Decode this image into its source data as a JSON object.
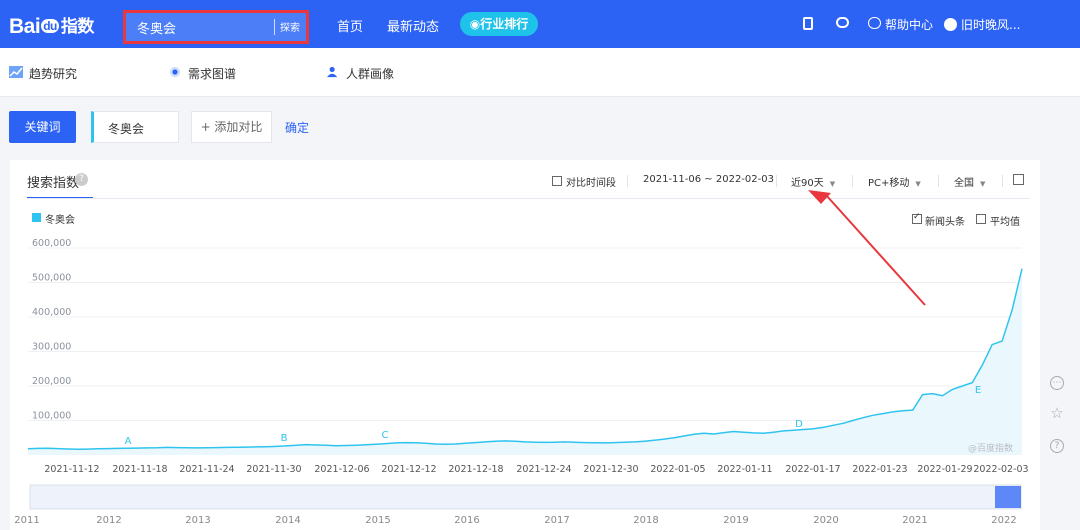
{
  "header": {
    "logo_text": "Bai",
    "logo_du": "du",
    "logo_zh": "指数",
    "search_value": "冬奥会",
    "search_button": "探索",
    "nav": [
      "首页",
      "最新动态"
    ],
    "rank_button": "行业排行",
    "help": "帮助中心",
    "user": "旧时晚风..."
  },
  "subnav": [
    "趋势研究",
    "需求图谱",
    "人群画像"
  ],
  "keyword_bar": {
    "label": "关键词",
    "keyword": "冬奥会",
    "add_compare": "+ 添加对比",
    "confirm": "确定"
  },
  "panel": {
    "title": "搜索指数",
    "qmark": "?",
    "compare_period": "对比时间段",
    "date_range": "2021-11-06 ~ 2022-02-03",
    "period": "近90天",
    "device": "PC+移动",
    "region": "全国",
    "legend": "冬奥会",
    "news_label": "新闻头条",
    "avg_label": "平均值",
    "watermark": "@百度指数"
  },
  "colors": {
    "accent": "#2d63f5",
    "series": "#2fc4ef",
    "highlight_box": "#e8383d"
  },
  "chart_data": {
    "type": "area",
    "ylim": [
      0,
      600000
    ],
    "yticks": [
      "100,000",
      "200,000",
      "300,000",
      "400,000",
      "500,000",
      "600,000"
    ],
    "xticks": [
      "2021-11-12",
      "2021-11-18",
      "2021-11-24",
      "2021-11-30",
      "2021-12-06",
      "2021-12-12",
      "2021-12-18",
      "2021-12-24",
      "2021-12-30",
      "2022-01-05",
      "2022-01-11",
      "2022-01-17",
      "2022-01-23",
      "2022-01-29",
      "2022-02-03"
    ],
    "series": [
      {
        "name": "冬奥会",
        "values": [
          18000,
          19000,
          19500,
          18500,
          17500,
          16500,
          17000,
          18000,
          18500,
          19000,
          19500,
          20000,
          20500,
          21000,
          22000,
          21500,
          21000,
          20500,
          21000,
          21500,
          22000,
          22500,
          23000,
          23500,
          24000,
          25000,
          26500,
          28000,
          30000,
          29000,
          28000,
          27000,
          27500,
          28500,
          29500,
          31000,
          33000,
          35000,
          36000,
          35500,
          34000,
          32000,
          31000,
          32000,
          34000,
          36000,
          38000,
          40000,
          41000,
          40000,
          38000,
          37000,
          36500,
          37000,
          38000,
          37000,
          36000,
          35500,
          35000,
          36000,
          37000,
          38000,
          40000,
          43000,
          46000,
          50000,
          55000,
          60000,
          63000,
          61000,
          65000,
          68000,
          66000,
          64000,
          63000,
          66000,
          70000,
          72000,
          74000,
          76000,
          80000,
          86000,
          92000,
          100000,
          108000,
          115000,
          120000,
          125000,
          128000,
          130000,
          175000,
          178000,
          172000,
          190000,
          200000,
          210000,
          260000,
          320000,
          330000,
          420000,
          540000
        ]
      }
    ],
    "annotations": [
      "A",
      "B",
      "C",
      "D",
      "E"
    ],
    "overview_years": [
      "2011",
      "2012",
      "2013",
      "2014",
      "2015",
      "2016",
      "2017",
      "2018",
      "2019",
      "2020",
      "2021",
      "2022"
    ]
  }
}
